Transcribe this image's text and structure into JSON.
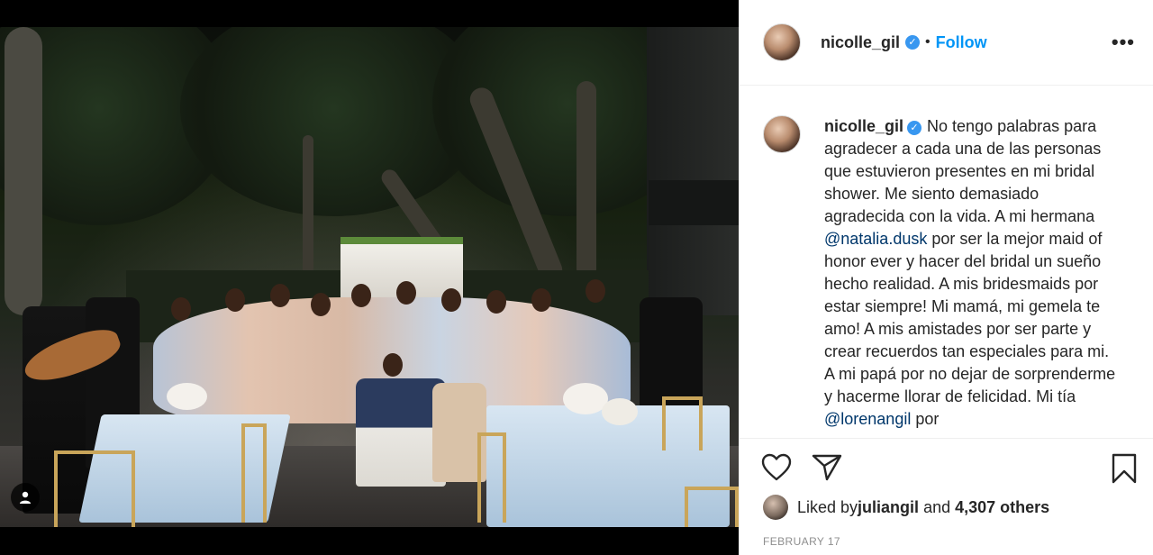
{
  "post": {
    "image_alt": "Bridal shower group photo"
  },
  "header": {
    "username": "nicolle_gil",
    "verified_icon": "verified-badge-icon",
    "separator": "•",
    "follow_label": "Follow",
    "more_label": "•••"
  },
  "caption": {
    "username": "nicolle_gil",
    "segments": {
      "part1": "No tengo palabras para agradecer a cada una de las personas que estuvieron presentes en mi bridal shower. Me siento demasiado agradecida con la vida. A mi hermana ",
      "mention1": "@natalia.dusk",
      "part2": " por ser la mejor maid of honor ever y hacer del bridal un sueño hecho realidad. A mis bridesmaids por estar siempre! Mi mamá, mi gemela te amo! A mis amistades por ser parte y crear recuerdos tan especiales para mi. A mi papá por no dejar de sorprenderme y hacerme llorar de felicidad. Mi tía ",
      "mention2": "@lorenangil",
      "part3": " por"
    }
  },
  "actions": {
    "like_icon": "heart-icon",
    "share_icon": "paper-plane-icon",
    "save_icon": "bookmark-icon"
  },
  "likes": {
    "prefix": "Liked by ",
    "user": "juliangil",
    "conjunction": " and ",
    "count": "4,307 others"
  },
  "date": "FEBRUARY 17",
  "colors": {
    "link": "#0095f6",
    "mention": "#00376b",
    "verified": "#3897f0"
  }
}
